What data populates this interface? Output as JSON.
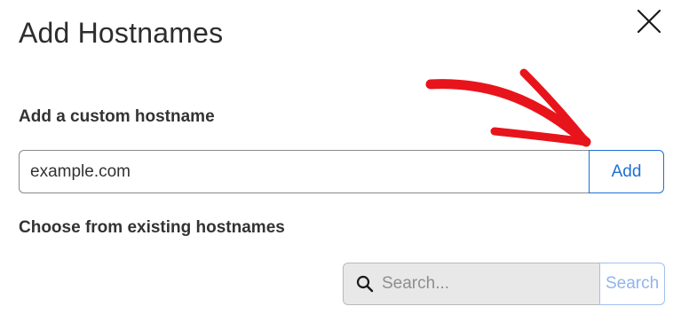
{
  "dialog": {
    "title": "Add Hostnames",
    "close_icon": "close-icon"
  },
  "custom_hostname": {
    "label": "Add a custom hostname",
    "input_value": "example.com",
    "add_button_label": "Add"
  },
  "existing_hostnames": {
    "label": "Choose from existing hostnames",
    "search_placeholder": "Search...",
    "search_button_label": "Search",
    "search_icon": "search-icon"
  },
  "annotation": {
    "arrow_color": "#e8141b"
  },
  "colors": {
    "accent": "#1f6fd6",
    "accent_disabled": "#8fb5ec",
    "search_box_bg": "#e8e8e8"
  }
}
